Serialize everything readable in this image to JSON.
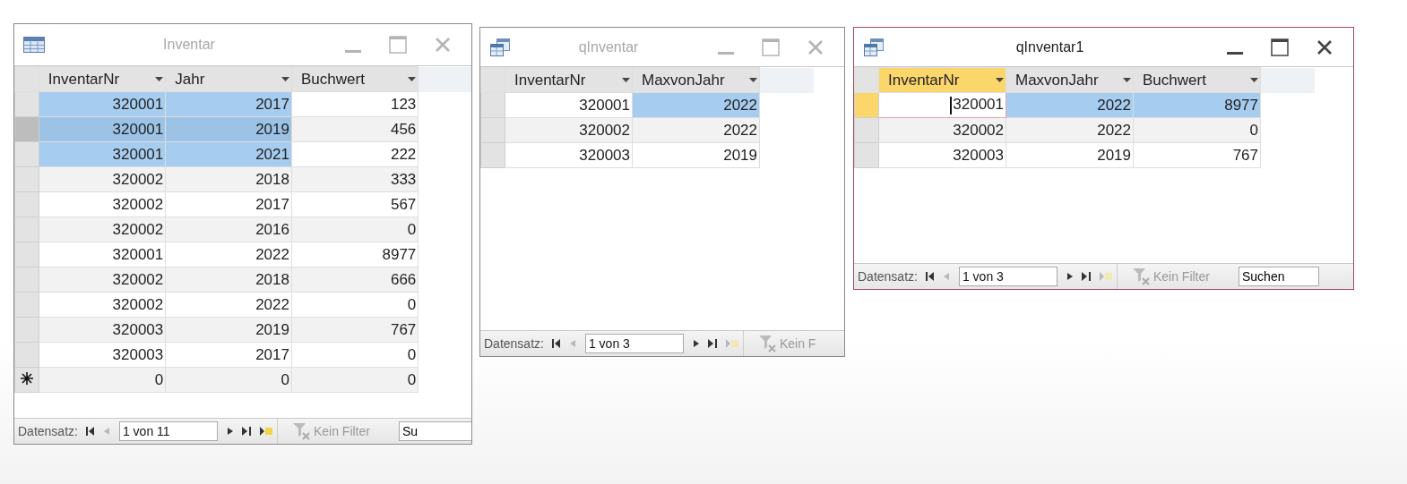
{
  "windows": [
    {
      "title": "Inventar",
      "kind": "table",
      "active": false,
      "columns": [
        {
          "label": "InventarNr",
          "active": false
        },
        {
          "label": "Jahr",
          "active": false
        },
        {
          "label": "Buchwert",
          "active": false
        }
      ],
      "rows": [
        {
          "kind": "record",
          "current": false,
          "cells": [
            {
              "text": "320001",
              "selected": true
            },
            {
              "text": "2017",
              "selected": true
            },
            {
              "text": "123",
              "selected": false
            }
          ]
        },
        {
          "kind": "record",
          "current": true,
          "cells": [
            {
              "text": "320001",
              "selected": true
            },
            {
              "text": "2019",
              "selected": true
            },
            {
              "text": "456",
              "selected": false
            }
          ]
        },
        {
          "kind": "record",
          "current": false,
          "cells": [
            {
              "text": "320001",
              "selected": true
            },
            {
              "text": "2021",
              "selected": true
            },
            {
              "text": "222",
              "selected": false
            }
          ]
        },
        {
          "kind": "record",
          "current": false,
          "cells": [
            {
              "text": "320002",
              "selected": false
            },
            {
              "text": "2018",
              "selected": false
            },
            {
              "text": "333",
              "selected": false
            }
          ]
        },
        {
          "kind": "record",
          "current": false,
          "cells": [
            {
              "text": "320002",
              "selected": false
            },
            {
              "text": "2017",
              "selected": false
            },
            {
              "text": "567",
              "selected": false
            }
          ]
        },
        {
          "kind": "record",
          "current": false,
          "cells": [
            {
              "text": "320002",
              "selected": false
            },
            {
              "text": "2016",
              "selected": false
            },
            {
              "text": "0",
              "selected": false
            }
          ]
        },
        {
          "kind": "record",
          "current": false,
          "cells": [
            {
              "text": "320001",
              "selected": false
            },
            {
              "text": "2022",
              "selected": false
            },
            {
              "text": "8977",
              "selected": false
            }
          ]
        },
        {
          "kind": "record",
          "current": false,
          "cells": [
            {
              "text": "320002",
              "selected": false
            },
            {
              "text": "2018",
              "selected": false
            },
            {
              "text": "666",
              "selected": false
            }
          ]
        },
        {
          "kind": "record",
          "current": false,
          "cells": [
            {
              "text": "320002",
              "selected": false
            },
            {
              "text": "2022",
              "selected": false
            },
            {
              "text": "0",
              "selected": false
            }
          ]
        },
        {
          "kind": "record",
          "current": false,
          "cells": [
            {
              "text": "320003",
              "selected": false
            },
            {
              "text": "2019",
              "selected": false
            },
            {
              "text": "767",
              "selected": false
            }
          ]
        },
        {
          "kind": "record",
          "current": false,
          "cells": [
            {
              "text": "320003",
              "selected": false
            },
            {
              "text": "2017",
              "selected": false
            },
            {
              "text": "0",
              "selected": false
            }
          ]
        },
        {
          "kind": "new",
          "current": false,
          "cells": [
            {
              "text": "0",
              "selected": false
            },
            {
              "text": "0",
              "selected": false
            },
            {
              "text": "0",
              "selected": false
            }
          ]
        }
      ],
      "nav": {
        "label": "Datensatz:",
        "record": "1 von 11",
        "buttons": [
          {
            "kind": "first",
            "disabled": false
          },
          {
            "kind": "prev",
            "disabled": true
          }
        ],
        "buttons_after": [
          {
            "kind": "next",
            "disabled": false
          },
          {
            "kind": "last",
            "disabled": false
          },
          {
            "kind": "new",
            "disabled": false
          }
        ],
        "filter": "Kein Filter",
        "search": "Su"
      }
    },
    {
      "title": "qInventar",
      "kind": "query",
      "active": false,
      "columns": [
        {
          "label": "InventarNr",
          "active": false
        },
        {
          "label": "MaxvonJahr",
          "active": false
        }
      ],
      "rows": [
        {
          "kind": "record",
          "current": false,
          "cells": [
            {
              "text": "320001",
              "selected": false
            },
            {
              "text": "2022",
              "selected": true
            }
          ]
        },
        {
          "kind": "record",
          "current": false,
          "cells": [
            {
              "text": "320002",
              "selected": false
            },
            {
              "text": "2022",
              "selected": false
            }
          ]
        },
        {
          "kind": "record",
          "current": false,
          "cells": [
            {
              "text": "320003",
              "selected": false
            },
            {
              "text": "2019",
              "selected": false
            }
          ]
        }
      ],
      "nav": {
        "label": "Datensatz:",
        "record": "1 von 3",
        "buttons": [
          {
            "kind": "first",
            "disabled": false
          },
          {
            "kind": "prev",
            "disabled": true
          }
        ],
        "buttons_after": [
          {
            "kind": "next",
            "disabled": false
          },
          {
            "kind": "last",
            "disabled": false
          },
          {
            "kind": "new",
            "disabled": true
          }
        ],
        "filter": "Kein F"
      }
    },
    {
      "title": "qInventar1",
      "kind": "query",
      "active": true,
      "columns": [
        {
          "label": "InventarNr",
          "active": true
        },
        {
          "label": "MaxvonJahr",
          "active": false
        },
        {
          "label": "Buchwert",
          "active": false
        }
      ],
      "rows": [
        {
          "kind": "record",
          "current": true,
          "cells": [
            {
              "text": "320001",
              "selected": false,
              "focused": true
            },
            {
              "text": "2022",
              "selected": true
            },
            {
              "text": "8977",
              "selected": true
            }
          ]
        },
        {
          "kind": "record",
          "current": false,
          "cells": [
            {
              "text": "320002",
              "selected": false
            },
            {
              "text": "2022",
              "selected": false
            },
            {
              "text": "0",
              "selected": false
            }
          ]
        },
        {
          "kind": "record",
          "current": false,
          "cells": [
            {
              "text": "320003",
              "selected": false
            },
            {
              "text": "2019",
              "selected": false
            },
            {
              "text": "767",
              "selected": false
            }
          ]
        }
      ],
      "nav": {
        "label": "Datensatz:",
        "record": "1 von 3",
        "buttons": [
          {
            "kind": "first",
            "disabled": false
          },
          {
            "kind": "prev",
            "disabled": true
          }
        ],
        "buttons_after": [
          {
            "kind": "next",
            "disabled": false
          },
          {
            "kind": "last",
            "disabled": false
          },
          {
            "kind": "new",
            "disabled": true
          }
        ],
        "filter": "Kein Filter",
        "search": "Suchen"
      }
    }
  ]
}
